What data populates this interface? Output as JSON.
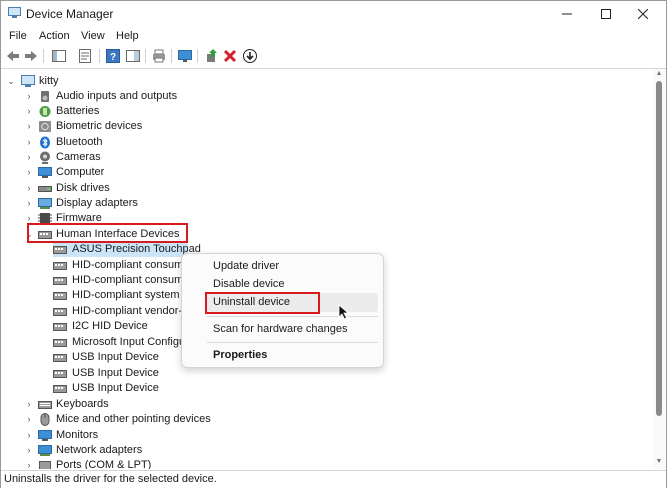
{
  "window": {
    "title": "Device Manager"
  },
  "menu": [
    "File",
    "Action",
    "View",
    "Help"
  ],
  "tree": {
    "root": "kitty",
    "categories": [
      {
        "label": "Audio inputs and outputs",
        "icon": "speaker-icon"
      },
      {
        "label": "Batteries",
        "icon": "battery-icon"
      },
      {
        "label": "Biometric devices",
        "icon": "fingerprint-icon"
      },
      {
        "label": "Bluetooth",
        "icon": "bluetooth-icon"
      },
      {
        "label": "Cameras",
        "icon": "camera-icon"
      },
      {
        "label": "Computer",
        "icon": "computer-icon"
      },
      {
        "label": "Disk drives",
        "icon": "disk-drive-icon"
      },
      {
        "label": "Display adapters",
        "icon": "display-adapter-icon"
      },
      {
        "label": "Firmware",
        "icon": "firmware-icon"
      },
      {
        "label": "Human Interface Devices",
        "icon": "hid-icon",
        "expanded": true
      }
    ],
    "hid_children": [
      "ASUS Precision Touchpad",
      "HID-compliant consume",
      "HID-compliant consume",
      "HID-compliant system cc",
      "HID-compliant vendor-d",
      "I2C HID Device",
      "Microsoft Input Configur",
      "USB Input Device",
      "USB Input Device",
      "USB Input Device"
    ],
    "after_categories": [
      {
        "label": "Keyboards",
        "icon": "keyboard-icon"
      },
      {
        "label": "Mice and other pointing devices",
        "icon": "mouse-icon"
      },
      {
        "label": "Monitors",
        "icon": "monitor-icon"
      },
      {
        "label": "Network adapters",
        "icon": "network-adapter-icon"
      },
      {
        "label": "Ports (COM & LPT)",
        "icon": "port-icon"
      }
    ]
  },
  "context_menu": {
    "update": "Update driver",
    "disable": "Disable device",
    "uninstall": "Uninstall device",
    "scan": "Scan for hardware changes",
    "properties": "Properties"
  },
  "status": "Uninstalls the driver for the selected device.",
  "colors": {
    "highlight": "#d71920",
    "selection": "#cce4f7"
  }
}
